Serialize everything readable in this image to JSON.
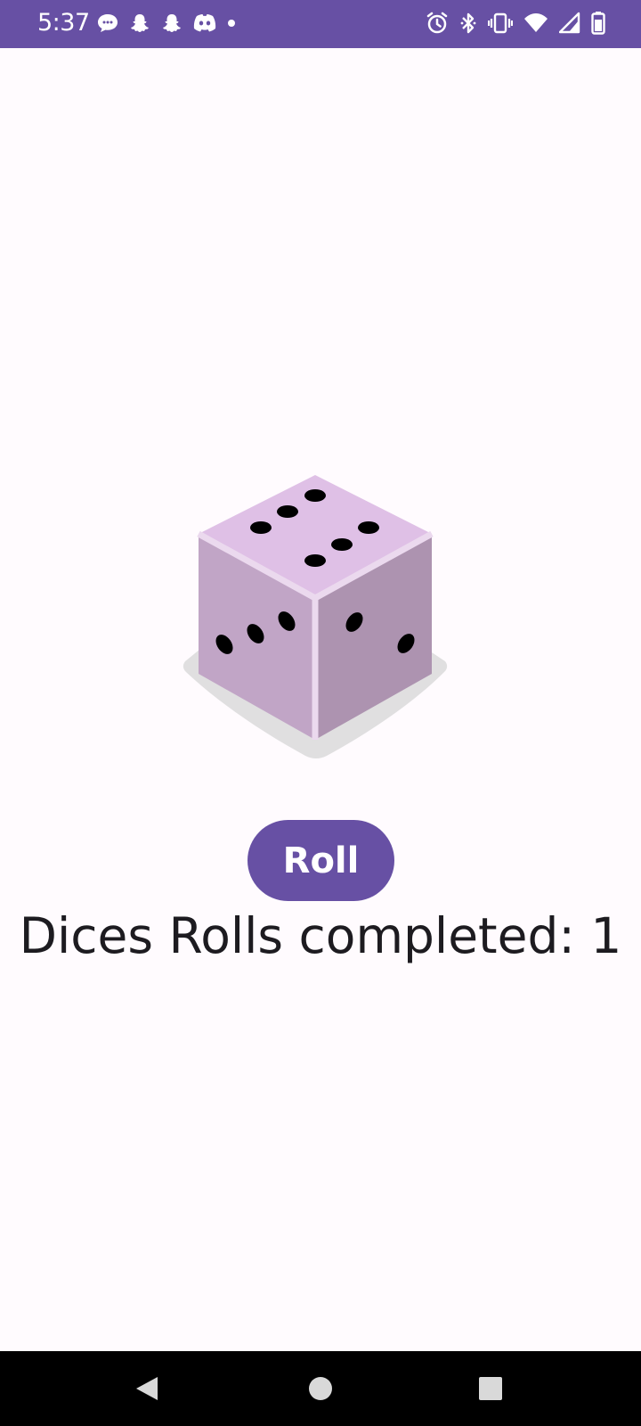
{
  "status_bar": {
    "time": "5:37",
    "background": "#6750a4",
    "left_icons": [
      "chat-bubble-icon",
      "snapchat-ghost-icon",
      "snapchat-ghost-icon",
      "discord-icon",
      "dot-icon"
    ],
    "right_icons": [
      "alarm-icon",
      "bluetooth-icon",
      "vibrate-icon",
      "wifi-icon",
      "cell-signal-icon",
      "battery-icon"
    ]
  },
  "dice": {
    "top_face_pips": 6,
    "left_face_pips": 3,
    "right_face_pips": 2,
    "top_color": "#dfc0e6",
    "left_color": "#c1a5c6",
    "right_color": "#ad93b0"
  },
  "roll_button": {
    "label": "Roll",
    "color": "#6750a4"
  },
  "rolls_text": "Dices Rolls completed: 1",
  "nav_bar": {
    "icons": [
      "back-icon",
      "home-icon",
      "recents-icon"
    ]
  }
}
